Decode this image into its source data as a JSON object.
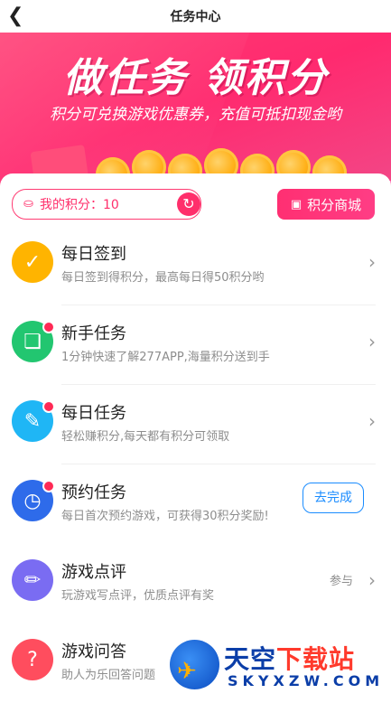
{
  "header": {
    "title": "任务中心",
    "back_icon": "chevron-left-icon"
  },
  "banner": {
    "headline": "做任务  领积分",
    "subtitle": "积分可兑换游戏优惠券，充值可抵扣现金哟",
    "colors": {
      "start": "#ff3d73",
      "end": "#f04c8b"
    }
  },
  "points": {
    "label": "我的积分：10",
    "icon": "coin-icon",
    "refresh_icon": "refresh-icon"
  },
  "mall": {
    "label": "积分商城",
    "icon": "store-icon"
  },
  "tasks": [
    {
      "name": "每日签到",
      "desc": "每日签到得积分，最高每日得50积分哟",
      "icon": "calendar-check-icon",
      "color": "#ffb400",
      "badge": false
    },
    {
      "name": "新手任务",
      "desc": "1分钟快速了解277APP,海量积分送到手",
      "icon": "copy-check-icon",
      "color": "#22c670",
      "badge": true
    },
    {
      "name": "每日任务",
      "desc": "轻松赚积分,每天都有积分可领取",
      "icon": "clipboard-icon",
      "color": "#1fb6f5",
      "badge": true
    },
    {
      "name": "预约任务",
      "desc": "每日首次预约游戏，可获得30积分奖励!",
      "icon": "calendar-clock-icon",
      "color": "#2e6bea",
      "badge": true,
      "action": "去完成"
    },
    {
      "name": "游戏点评",
      "desc": "玩游戏写点评，优质点评有奖",
      "icon": "pencil-icon",
      "color": "#7a6cf2",
      "badge": false,
      "extra": "参与"
    },
    {
      "name": "游戏问答",
      "desc": "助人为乐回答问题",
      "icon": "question-chat-icon",
      "color": "#ff4d5e",
      "badge": false
    }
  ],
  "watermark": {
    "name_a": "天空",
    "name_b": "下载站",
    "url": "SKYXZW.COM"
  }
}
